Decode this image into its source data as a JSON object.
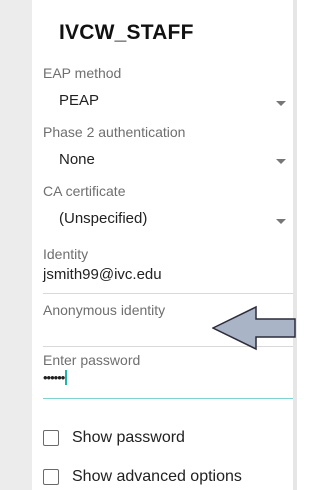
{
  "network": {
    "name": "IVCW_STAFF"
  },
  "eap_method": {
    "label": "EAP method",
    "value": "PEAP"
  },
  "phase2": {
    "label": "Phase 2 authentication",
    "value": "None"
  },
  "ca_certificate": {
    "label": "CA certificate",
    "value": "(Unspecified)"
  },
  "identity": {
    "label": "Identity",
    "value": "jsmith99@ivc.edu"
  },
  "anonymous_identity": {
    "label": "Anonymous identity",
    "value": ""
  },
  "password": {
    "label": "Enter password",
    "value": "••••••"
  },
  "options": {
    "show_password": "Show password",
    "show_advanced": "Show advanced options"
  },
  "colors": {
    "accent": "#1eb6ab",
    "annotation_arrow_fill": "#a9b4c6",
    "annotation_arrow_stroke": "#2c2c3a"
  },
  "annotation": {
    "shape": "left-arrow-icon"
  }
}
